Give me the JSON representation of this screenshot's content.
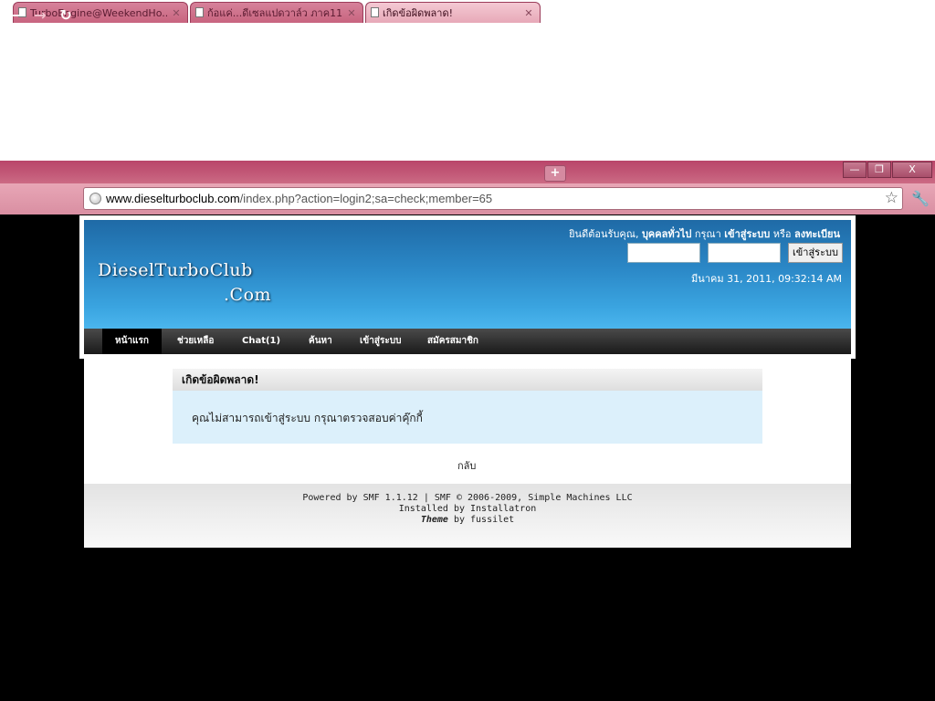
{
  "browser": {
    "tabs": [
      {
        "label": "TurboEngine@WeekendHo...",
        "active": false
      },
      {
        "label": "ก้อแค่...ดีเซลแปดวาล์ว ภาค11",
        "active": false
      },
      {
        "label": "เกิดข้อผิดพลาด!",
        "active": true
      }
    ],
    "new_tab_icon": "+",
    "window": {
      "minimize": "—",
      "restore": "❐",
      "close": "X"
    },
    "url_host": "www.dieselturboclub.com",
    "url_path": "/index.php?action=login2;sa=check;member=65",
    "icons": {
      "back": "back-arrow-icon",
      "forward": "forward-arrow-icon",
      "reload": "reload-icon",
      "star": "bookmark-star-icon",
      "wrench": "wrench-icon",
      "globe": "globe-icon"
    }
  },
  "site": {
    "logo_line1": "DieselTurboClub",
    "logo_line2": ".Com",
    "welcome_prefix": "ยินดีต้อนรับคุณ,",
    "welcome_user": "บุคคลทั่วไป",
    "welcome_mid": "กรุณา",
    "welcome_login": "เข้าสู่ระบบ",
    "welcome_or": "หรือ",
    "welcome_register": "ลงทะเบียน",
    "login_button": "เข้าสู่ระบบ",
    "datetime": "มีนาคม 31, 2011, 09:32:14 AM"
  },
  "menu": [
    {
      "label": "หน้าแรก",
      "active": true
    },
    {
      "label": "ช่วยเหลือ",
      "active": false
    },
    {
      "label": "Chat(1)",
      "active": false
    },
    {
      "label": "ค้นหา",
      "active": false
    },
    {
      "label": "เข้าสู่ระบบ",
      "active": false
    },
    {
      "label": "สมัครสมาชิก",
      "active": false
    }
  ],
  "error": {
    "title": "เกิดข้อผิดพลาด!",
    "message": "คุณไม่สามารถเข้าสู่ระบบ กรุณาตรวจสอบค่าคุ๊กกี้",
    "back": "กลับ"
  },
  "footer": {
    "line1": "Powered by SMF 1.1.12 | SMF © 2006-2009, Simple Machines LLC",
    "line2": "Installed by Installatron",
    "line3_theme": "Theme",
    "line3_rest": "by fussilet"
  }
}
